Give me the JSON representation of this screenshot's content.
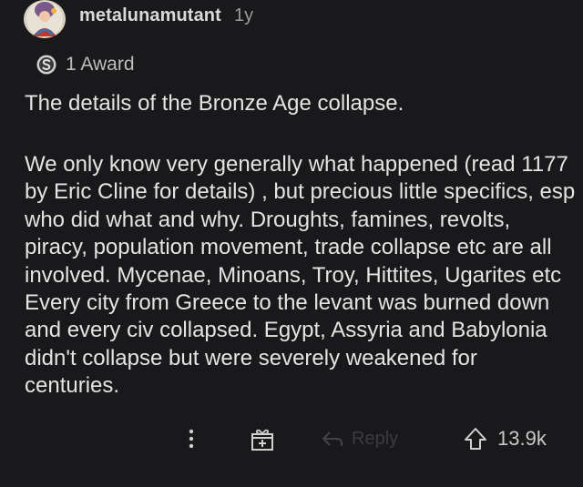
{
  "comment": {
    "author": "metalunamutant",
    "age": "1y",
    "award_label": "1 Award",
    "paragraphs": [
      "The details of the Bronze Age collapse.",
      "We only know very generally what happened (read 1177 by Eric Cline for details) , but precious little specifics, esp who did what and why. Droughts, famines, revolts, piracy, population movement, trade collapse etc are all involved. Mycenae, Minoans, Troy, Hittites, Ugarites etc Every city from Greece to the levant was burned down and every civ collapsed. Egypt, Assyria and Babylonia didn't collapse but were severely weakened for centuries."
    ]
  },
  "actions": {
    "more_icon": "vertical-ellipsis-icon",
    "gift_icon": "gift-icon",
    "reply_icon": "reply-arrow-icon",
    "reply_label": "Reply",
    "upvote_icon": "upvote-arrow-icon",
    "score": "13.9k"
  },
  "colors": {
    "background": "#19191b",
    "text": "#e4e4e4",
    "muted": "#9a9a9a"
  }
}
